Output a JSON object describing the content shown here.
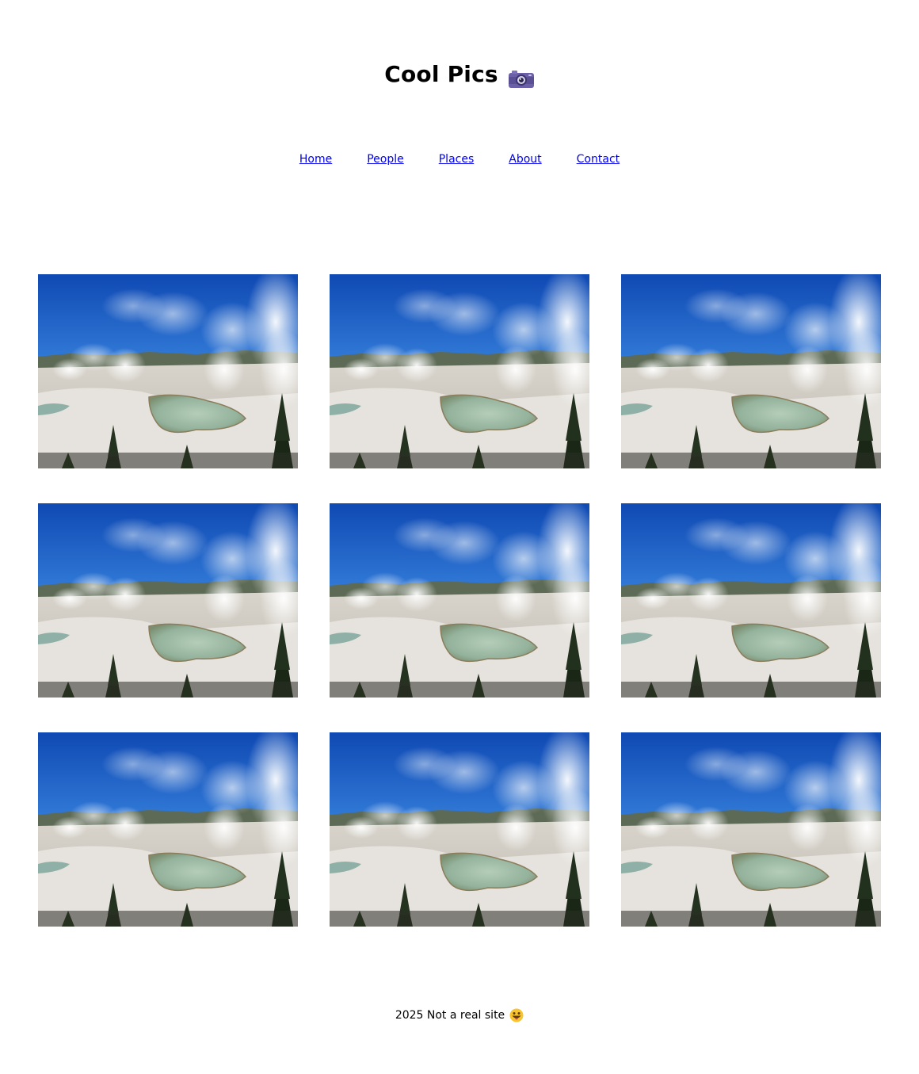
{
  "header": {
    "title": "Cool Pics",
    "title_icon": "camera-icon"
  },
  "nav": {
    "items": [
      {
        "label": "Home"
      },
      {
        "label": "People"
      },
      {
        "label": "Places"
      },
      {
        "label": "About"
      },
      {
        "label": "Contact"
      }
    ]
  },
  "gallery": {
    "image_count": 9,
    "image_subject": "geyser-basin-photo"
  },
  "footer": {
    "text": "2025 Not a real site",
    "icon": "grinning-face-with-tongue-icon"
  },
  "colors": {
    "link": "#0000ee",
    "sky": "#1f5fc8",
    "pool": "#8fb2a2"
  }
}
